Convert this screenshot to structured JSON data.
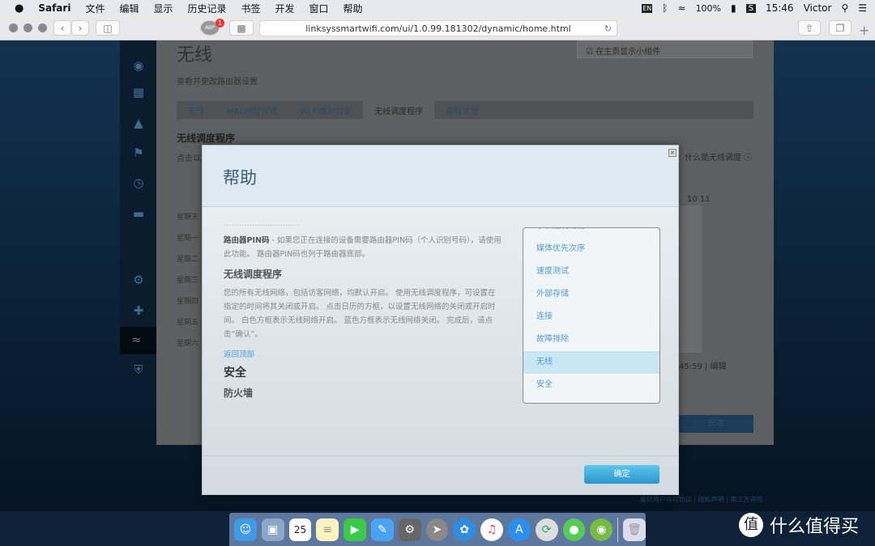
{
  "menubar": {
    "apple": "",
    "app": "Safari",
    "items": [
      "文件",
      "编辑",
      "显示",
      "历史记录",
      "书签",
      "开发",
      "窗口",
      "帮助"
    ],
    "input": "EN",
    "battery": "100%",
    "time": "15:46",
    "user": "Victor"
  },
  "browser": {
    "url": "linksyssmartwifi.com/ui/1.0.99.181302/dynamic/home.html",
    "abp_badge": "1",
    "abp": "ABP"
  },
  "bg": {
    "title": "无线",
    "subtitle": "查看并更改路由器设置",
    "widget": "在主页显示小组件",
    "tabs": [
      "无线",
      "MAC地址过滤",
      "Wi-Fi保护设置",
      "无线调度程序",
      "高级设置"
    ],
    "active_tab": 3,
    "heading": "无线调度程序",
    "desc": "点击以",
    "whatis": "什么是无线调度",
    "hours": "10  11",
    "days": [
      "星期天",
      "星期一",
      "星期二",
      "星期三",
      "星期四",
      "星期五",
      "星期六"
    ],
    "time_edit": "45:59 | 编辑",
    "apply": "应用",
    "footer": "最终用户许可协议 | 隐私声明 | 第三方许可"
  },
  "modal": {
    "title": "帮助",
    "close": "×",
    "cut_line": "…………………………",
    "pin_bold": "路由器PIN码",
    "pin_text": " - 如果您正在连接的设备需要路由器PIN码（个人识别号码），请使用此功能。 路由器PIN码也列于路由器底部。",
    "sched_title": "无线调度程序",
    "sched_text": "您的所有无线网络，包括访客网络，均默认开启。 使用无线调度程序，可设置在指定的时间将其关闭或开启。 点击日历的方框，以设置无线网络的关闭或开启时间。 白色方框表示无线网络开启。 蓝色方框表示无线网络关闭。 完成后，请点击“确认”。",
    "back_top": "返回顶部",
    "security": "安全",
    "firewall": "防火墙",
    "list": [
      "家长控制功能",
      "媒体优先次序",
      "速度测试",
      "外部存储",
      "连接",
      "故障排除",
      "无线",
      "安全"
    ],
    "selected": "无线",
    "ok": "确定"
  },
  "dock": [
    "finder",
    "preview",
    "calendar",
    "notes",
    "facetime",
    "pen",
    "system-preferences",
    "launchpad",
    "safari",
    "itunes",
    "app-store",
    "vpn",
    "wechat",
    "android"
  ],
  "calendar_day": "25",
  "watermark": {
    "logo": "值",
    "text": "什么值得买"
  }
}
